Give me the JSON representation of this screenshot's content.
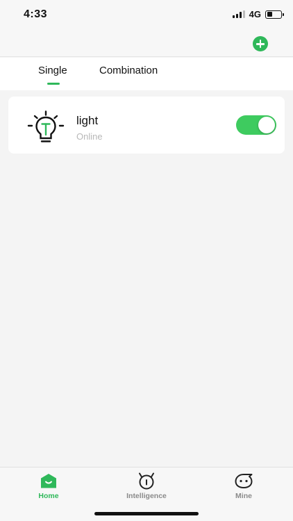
{
  "status_bar": {
    "time": "4:33",
    "network": "4G",
    "battery_level": 0.4
  },
  "header": {
    "add_icon": "plus-circle-icon"
  },
  "tabs": [
    {
      "label": "Single",
      "active": true
    },
    {
      "label": "Combination",
      "active": false
    }
  ],
  "devices": [
    {
      "name": "light",
      "status": "Online",
      "power_on": true,
      "icon": "light-bulb-icon"
    }
  ],
  "bottom_nav": [
    {
      "label": "Home",
      "icon": "home-icon",
      "active": true
    },
    {
      "label": "Intelligence",
      "icon": "intelligence-icon",
      "active": false
    },
    {
      "label": "Mine",
      "icon": "mine-face-icon",
      "active": false
    }
  ],
  "colors": {
    "accent": "#2fb85a",
    "toggle_on": "#3ecb5f",
    "muted_text": "#b8b8b8",
    "background": "#f4f4f4"
  }
}
